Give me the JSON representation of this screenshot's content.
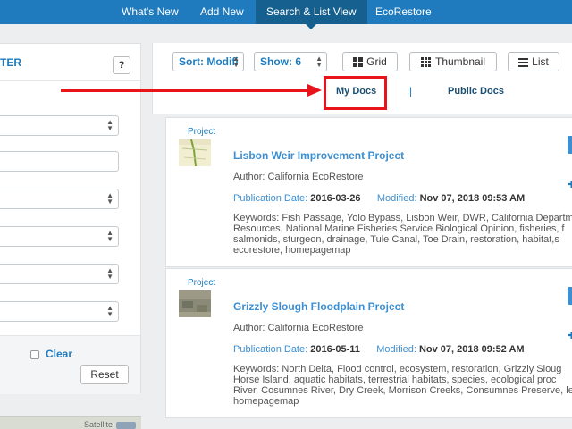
{
  "nav": {
    "items": [
      {
        "label": "What's New"
      },
      {
        "label": "Add New"
      },
      {
        "label": "Search & List View"
      },
      {
        "label": "EcoRestore"
      }
    ]
  },
  "filter": {
    "title_fragment": "TER",
    "help_label": "?",
    "clear_label": "Clear",
    "reset_label": "Reset",
    "map_label": "Satellite"
  },
  "toolbar": {
    "sort_value": "Sort: Modifi",
    "show_value": "Show: 6",
    "grid_label": "Grid",
    "thumbnail_label": "Thumbnail",
    "list_label": "List"
  },
  "tabs": {
    "my_docs": "My Docs",
    "separator": "|",
    "public_docs": "Public Docs"
  },
  "results": [
    {
      "type": "Project",
      "title": "Lisbon Weir Improvement Project",
      "author": "Author: California EcoRestore",
      "pub_label": "Publication Date:",
      "pub_date": "2016-03-26",
      "mod_label": "Modified:",
      "mod_date": "Nov 07, 2018 09:53 AM",
      "keywords": "Keywords: Fish Passage, Yolo Bypass, Lisbon Weir, DWR, California Departm Resources, National Marine Fisheries Service Biological Opinion, fisheries, f salmonids, sturgeon, drainage, Tule Canal, Toe Drain, restoration, habitat,s ecorestore, homepagemap"
    },
    {
      "type": "Project",
      "title": "Grizzly Slough Floodplain Project",
      "author": "Author: California EcoRestore",
      "pub_label": "Publication Date:",
      "pub_date": "2016-05-11",
      "mod_label": "Modified:",
      "mod_date": "Nov 07, 2018 09:52 AM",
      "keywords": "Keywords: North Delta, Flood control, ecosystem, restoration, Grizzly Sloug Horse Island, aquatic habitats, terrestrial habitats, species, ecological proc River, Cosumnes River, Dry Creek, Morrison Creeks, Consumnes Preserve, le homepagemap"
    }
  ],
  "colors": {
    "nav_bg": "#1f7bbd",
    "nav_active": "#15608f",
    "link": "#3d8fd1",
    "annotation_red": "#e8141a"
  }
}
